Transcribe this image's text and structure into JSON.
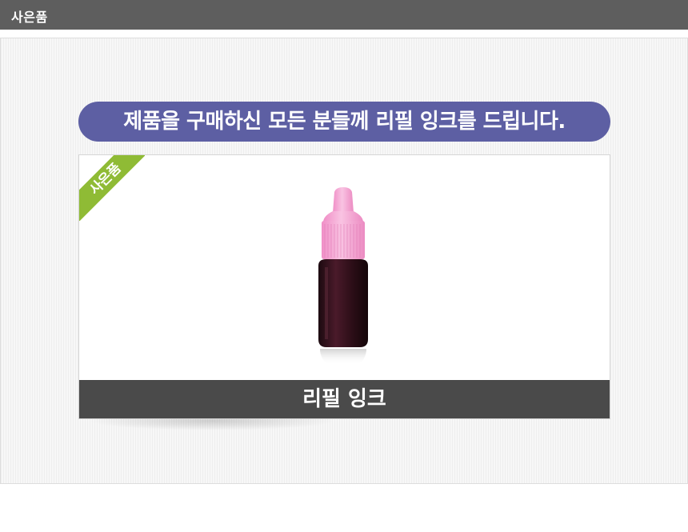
{
  "header": {
    "title": "사은품"
  },
  "banner": {
    "text": "제품을 구매하신 모든 분들께 리필 잉크를 드립니다."
  },
  "gift_card": {
    "ribbon_label": "사은품",
    "product_name": "리필 잉크",
    "product_icon": "ink-bottle-icon"
  },
  "colors": {
    "header_bg": "#5e5e5e",
    "banner_bg": "#5d5fa3",
    "ribbon_bg": "#8fbb35",
    "caption_bg": "#4a4a4a",
    "cap_pink": "#f3a9d5",
    "bottle_dark": "#3a1420"
  }
}
